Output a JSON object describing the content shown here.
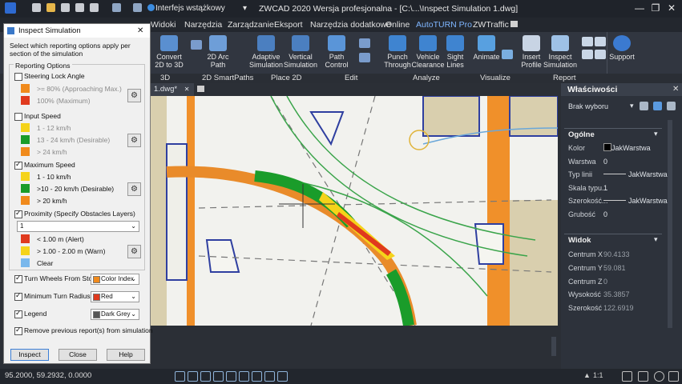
{
  "titlebar": {
    "workspace": "Interfejs wstążkowy",
    "title": "ZWCAD 2020 Wersja profesjonalna - [C:\\...\\Inspect Simulation 1.dwg]",
    "minimize": "—",
    "restore": "❐",
    "close": "✕"
  },
  "menu": {
    "items": [
      "Widoki",
      "Narzędzia",
      "Zarządzanie",
      "Eksport",
      "Narzędzia dodatkowe",
      "Online",
      "AutoTURN Pro",
      "ZWTraffic"
    ]
  },
  "ribbon": {
    "buttons": [
      {
        "label": "Convert 2D to 3D"
      },
      {
        "label": "2D Arc Path"
      },
      {
        "label": "Adaptive Simulation"
      },
      {
        "label": "Vertical Simulation"
      },
      {
        "label": "Path Control"
      },
      {
        "label": "Punch Through"
      },
      {
        "label": "Vehicle Clearance"
      },
      {
        "label": "Sight Lines"
      },
      {
        "label": "Animate"
      },
      {
        "label": "Insert Profile"
      },
      {
        "label": "Inspect Simulation"
      },
      {
        "label": "Support"
      }
    ],
    "groups": [
      "3D",
      "2D SmartPaths",
      "Place 2D",
      "Edit",
      "Analyze",
      "Visualize",
      "Report"
    ]
  },
  "doctab": {
    "label": "1.dwg*",
    "close": "✕"
  },
  "status": {
    "coords": "95.2000, 59.2932, 0.0000",
    "scale": "1:1"
  },
  "properties": {
    "title": "Właściwości",
    "selection": "Brak wyboru",
    "general_header": "Ogólne",
    "general": [
      {
        "label": "Kolor",
        "value": "JakWarstwa"
      },
      {
        "label": "Warstwa",
        "value": "0"
      },
      {
        "label": "Typ linii",
        "value": "JakWarstwa"
      },
      {
        "label": "Skala typu...",
        "value": "1"
      },
      {
        "label": "Szerokość...",
        "value": "JakWarstwa"
      },
      {
        "label": "Grubość",
        "value": "0"
      }
    ],
    "view_header": "Widok",
    "view": [
      {
        "label": "Centrum X",
        "value": "90.4133"
      },
      {
        "label": "Centrum Y",
        "value": "59.081"
      },
      {
        "label": "Centrum Z",
        "value": "0"
      },
      {
        "label": "Wysokość",
        "value": "35.3857"
      },
      {
        "label": "Szerokość",
        "value": "122.6919"
      }
    ]
  },
  "dialog": {
    "title": "Inspect Simulation",
    "close": "✕",
    "intro": "Select which reporting options apply per section of the simulation",
    "group_label": "Reporting Options",
    "steering": {
      "label": "Steering Lock Angle",
      "rows": [
        ">= 80% (Approaching Max.)",
        "100% (Maximum)"
      ]
    },
    "input_speed": {
      "label": "Input Speed",
      "rows": [
        "1 - 12 km/h",
        "13 - 24 km/h (Desirable)",
        "> 24 km/h"
      ]
    },
    "max_speed": {
      "label": "Maximum Speed",
      "rows": [
        "1 - 10 km/h",
        ">10 - 20 km/h (Desirable)",
        "> 20 km/h"
      ]
    },
    "proximity": {
      "label": "Proximity (Specify Obstacles Layers)",
      "layer": "1",
      "rows": [
        "< 1.00 m (Alert)",
        "> 1.00 - 2.00 m (Warn)",
        "Clear"
      ]
    },
    "turn_wheels": {
      "label": "Turn Wheels From Stop",
      "value": "Color Index"
    },
    "min_radius": {
      "label": "Minimum Turn Radius",
      "value": "Red"
    },
    "legend": {
      "label": "Legend",
      "value": "Dark Grey"
    },
    "remove_prev": {
      "label": "Remove previous report(s) from simulation"
    },
    "buttons": {
      "inspect": "Inspect",
      "close": "Close",
      "help": "Help"
    },
    "colors": {
      "orange": "#f08a1c",
      "red": "#e03a1e",
      "green": "#1a9c2a",
      "yellow": "#f5d31a",
      "lightblue": "#79b8ec"
    }
  }
}
